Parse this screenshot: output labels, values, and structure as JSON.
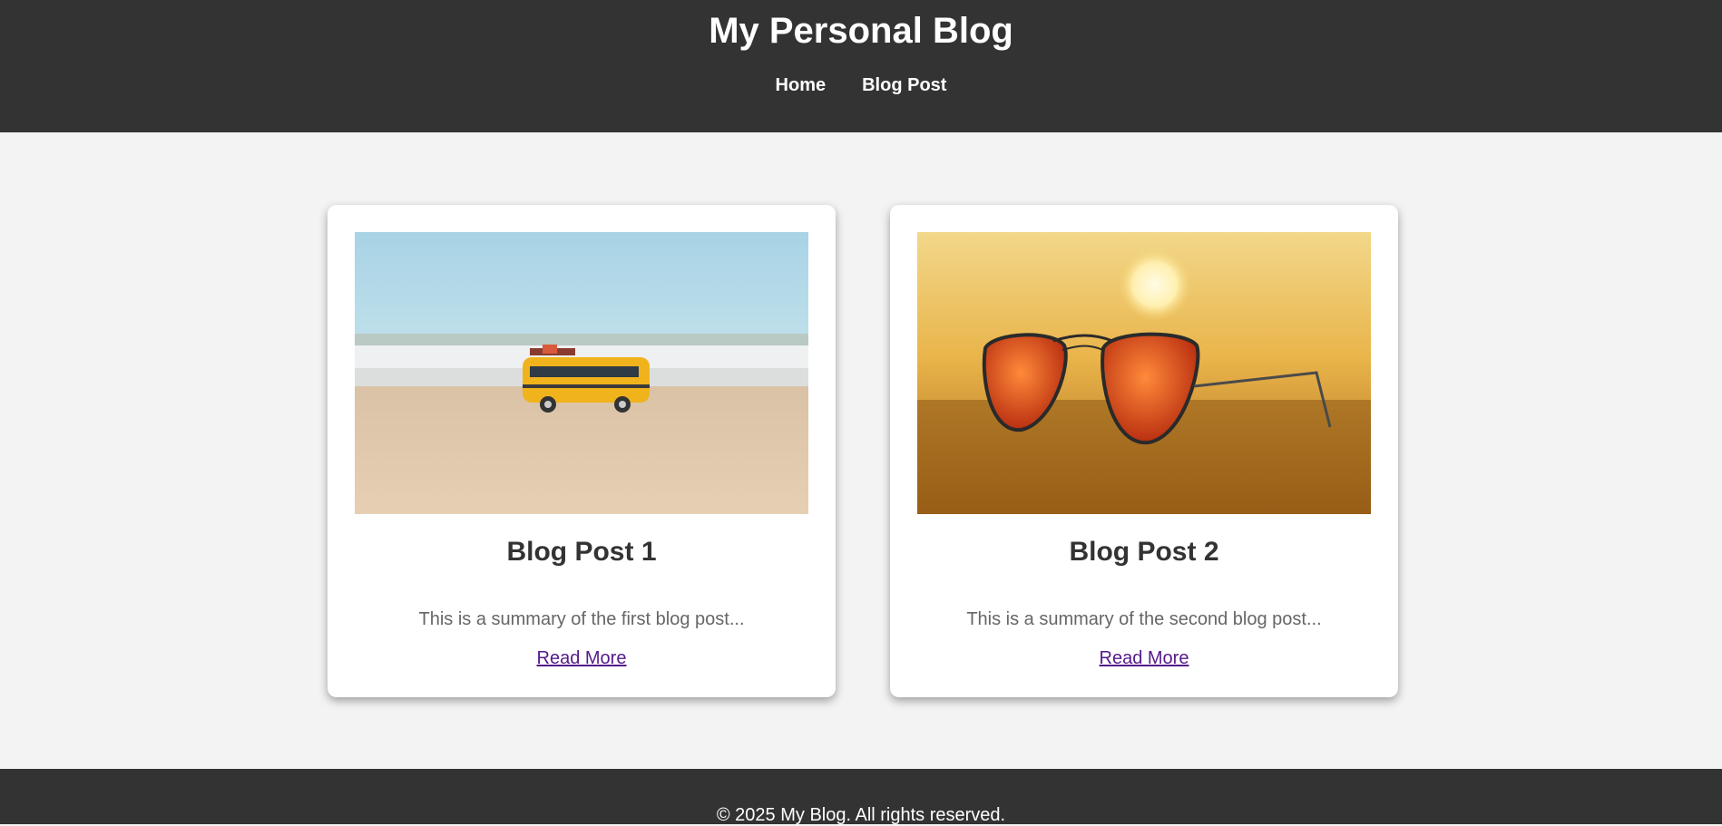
{
  "header": {
    "title": "My Personal Blog",
    "nav": [
      "Home",
      "Blog Post"
    ]
  },
  "posts": [
    {
      "title": "Blog Post 1",
      "summary": "This is a summary of the first blog post...",
      "link_label": "Read More"
    },
    {
      "title": "Blog Post 2",
      "summary": "This is a summary of the second blog post...",
      "link_label": "Read More"
    }
  ],
  "footer": {
    "text": "© 2025 My Blog. All rights reserved."
  },
  "colors": {
    "header_bg": "#333333",
    "page_bg": "#f3f3f3",
    "link_visited": "#551a8b"
  }
}
